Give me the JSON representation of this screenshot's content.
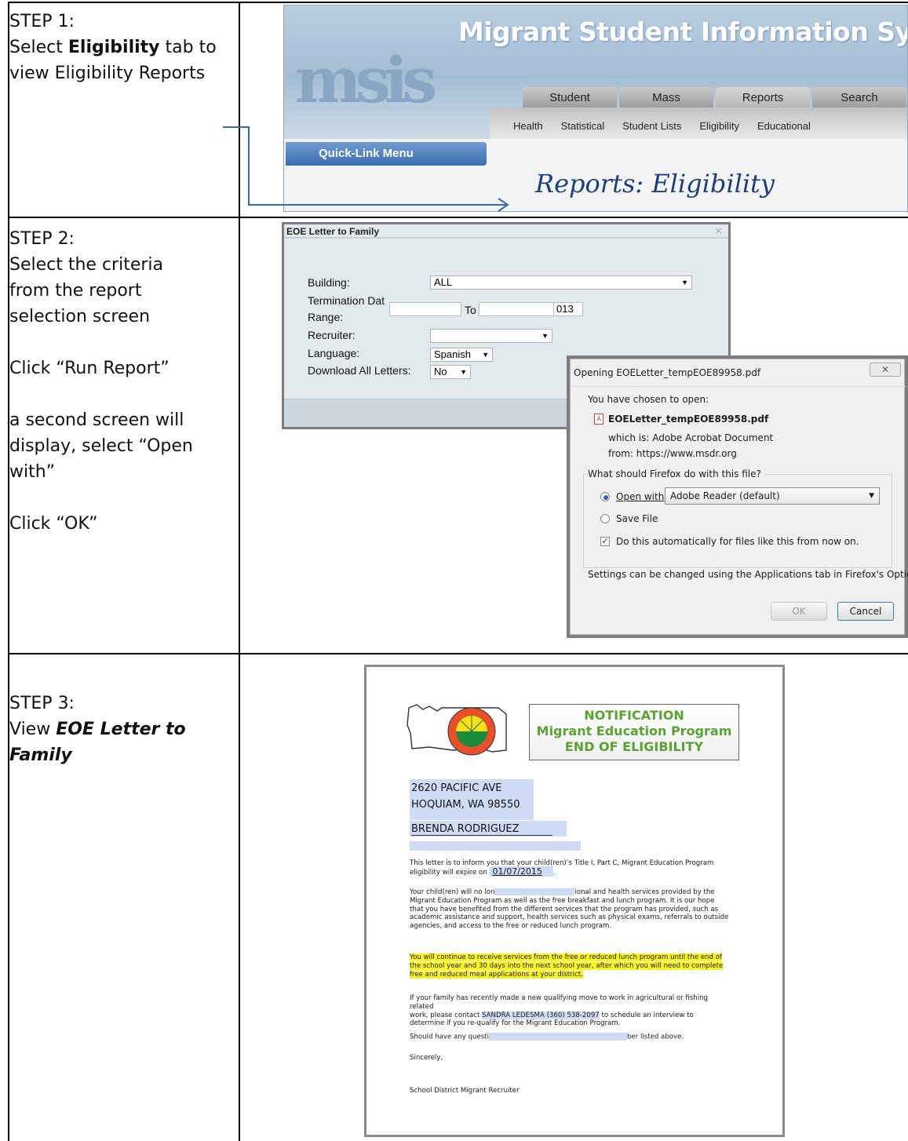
{
  "steps": [
    {
      "title": "STEP 1:",
      "text_before": "Select ",
      "bold": "Eligibility",
      "text_after": " tab to view Eligibility Reports"
    },
    {
      "title": "STEP 2:",
      "line1": "Select the criteria from the report selection screen",
      "line2": "Click  “Run Report”",
      "line3": "a second screen will display, select “Open with”",
      "line4": "Click  “OK”"
    },
    {
      "title": "STEP 3:",
      "text_before": "View ",
      "bold_italic": "EOE Letter to Family"
    }
  ],
  "msis": {
    "logo": "msis",
    "system_title": "Migrant Student Information System",
    "tabs": [
      "Student",
      "Mass",
      "Reports",
      "Search"
    ],
    "subnav": [
      "Health",
      "Statistical",
      "Student Lists",
      "Eligibility",
      "Educational"
    ],
    "quick_link": "Quick-Link Menu",
    "page_title": "Reports: Eligibility"
  },
  "eoe_dialog": {
    "title": "EOE Letter to Family",
    "close": "×",
    "building_label": "Building:",
    "building_value": "ALL",
    "termination_label_1": "Termination Dat",
    "termination_label_2": "Range:",
    "to_label": "To",
    "range_end_partial": "013",
    "recruiter_label": "Recruiter:",
    "language_label": "Language:",
    "language_value": "Spanish",
    "download_label": "Download All Letters:",
    "download_value": "No"
  },
  "ff_dialog": {
    "title": "Opening EOELetter_tempEOE89958.pdf",
    "close": "✕",
    "chosen": "You have chosen to open:",
    "filename": "EOELetter_tempEOE89958.pdf",
    "which_is": "which is:  Adobe Acrobat Document",
    "from": "from:  https://www.msdr.org",
    "question": "What should Firefox do with this file?",
    "open_with": "Open with",
    "open_with_app": "Adobe Reader  (default)",
    "save_file": "Save File",
    "do_auto": "Do this automatically for files like this from now on.",
    "settings_note": "Settings can be changed using the Applications tab in Firefox's Options.",
    "ok": "OK",
    "cancel": "Cancel"
  },
  "letter": {
    "notif_1": "NOTIFICATION",
    "notif_2": "Migrant Education Program",
    "notif_3": "END OF ELIGIBILITY",
    "addr_1": "2620 PACIFIC AVE",
    "addr_2": "HOQUIAM, WA 98550",
    "name": "BRENDA RODRIGUEZ",
    "p1_a": "This letter is to inform you that your child(ren)’s Title I, Part C, Migrant Education Program",
    "p1_b": "eligibility will expire on ",
    "p1_date": "01/07/2015",
    "p2_a": "Your child(ren) will no lon",
    "p2_b": "ional and health services provided by the",
    "p2_c": "Migrant Education Program as well as the free breakfast and lunch program.   It is our hope",
    "p2_d": "that you have benefited from the different services that the program has provided, such as",
    "p2_e": "academic assistance and support, health services such as physical exams, referrals to outside",
    "p2_f": "agencies, and access to the free or reduced lunch program.",
    "p3_a": "You will continue to receive services from the free or reduced lunch program until the end of",
    "p3_b": "the school year and 30 days into the next school year, after which you will need to complete",
    "p3_c": "free and reduced meal applications at your district.",
    "p4_a": "If your family has recently made a new qualifying move to work in agricultural or fishing related",
    "p4_b": "work, please contact ",
    "p4_contact": "SANDRA  LEDESMA (360) 538-2097",
    "p4_c": " to schedule an interview to",
    "p4_d": "determine if you re-qualify for the Migrant Education Program.",
    "p5_a": "Should have any questi",
    "p5_b": "ber listed above.",
    "p6": "Sincerely,",
    "p7": "School District Migrant Recruiter"
  },
  "colors": {
    "msis_blue": "#1f3f7a",
    "notif_green": "#5aa332",
    "highlight_yellow": "#fbf51d",
    "highlight_blue": "#d0dbf6",
    "arrow_blue": "#3a68ad"
  }
}
